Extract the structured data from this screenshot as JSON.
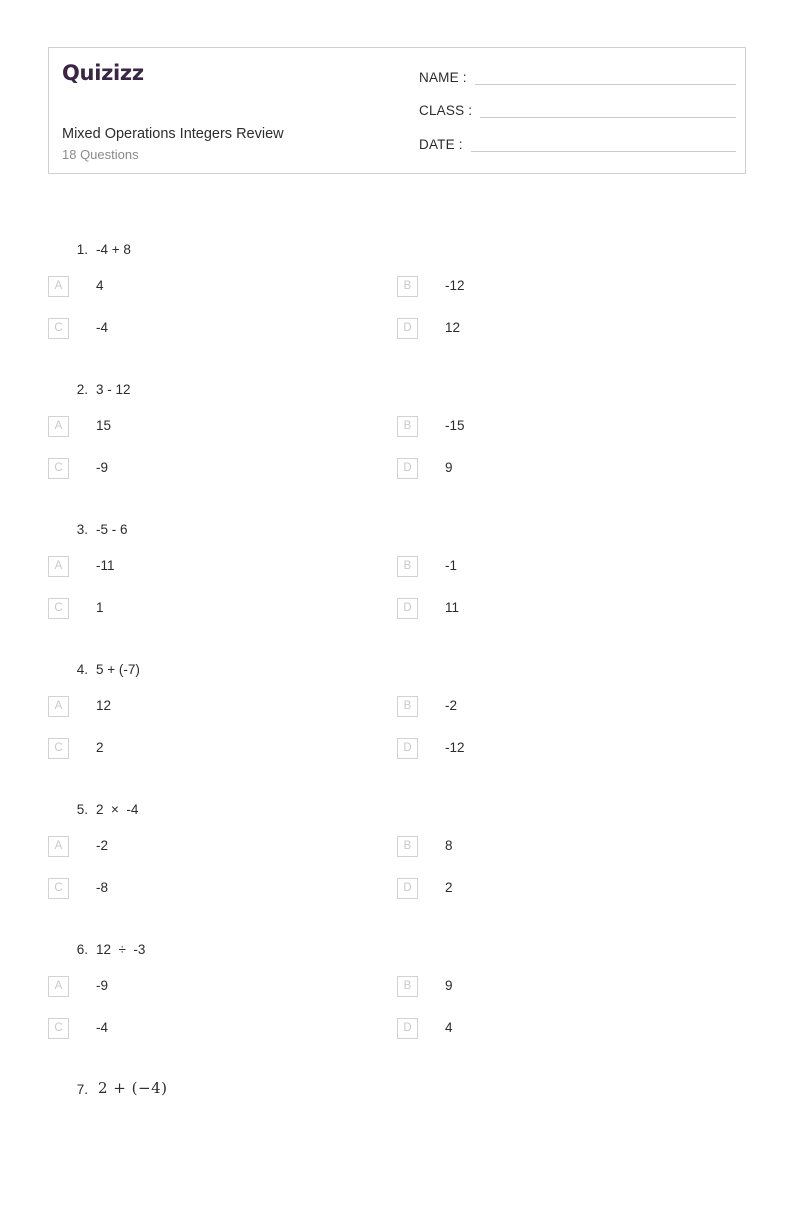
{
  "header": {
    "logo_text": "Quizizz",
    "logo_color": "#3b2544",
    "title": "Mixed Operations Integers Review",
    "subtitle": "18 Questions",
    "fields": [
      {
        "label": "NAME :",
        "value": ""
      },
      {
        "label": "CLASS :",
        "value": ""
      },
      {
        "label": "DATE  :",
        "value": ""
      }
    ]
  },
  "questions": [
    {
      "number": "1.",
      "text": "-4 + 8",
      "mathmode": false,
      "options": [
        {
          "letter": "A",
          "text": "4"
        },
        {
          "letter": "B",
          "text": "-12"
        },
        {
          "letter": "C",
          "text": "-4"
        },
        {
          "letter": "D",
          "text": "12"
        }
      ]
    },
    {
      "number": "2.",
      "text": "3 - 12",
      "mathmode": false,
      "options": [
        {
          "letter": "A",
          "text": "15"
        },
        {
          "letter": "B",
          "text": "-15"
        },
        {
          "letter": "C",
          "text": "-9"
        },
        {
          "letter": "D",
          "text": "9"
        }
      ]
    },
    {
      "number": "3.",
      "text": "-5 - 6",
      "mathmode": false,
      "options": [
        {
          "letter": "A",
          "text": "-11"
        },
        {
          "letter": "B",
          "text": "-1"
        },
        {
          "letter": "C",
          "text": "1"
        },
        {
          "letter": "D",
          "text": "11"
        }
      ]
    },
    {
      "number": "4.",
      "text": "5 + (-7)",
      "mathmode": false,
      "options": [
        {
          "letter": "A",
          "text": "12"
        },
        {
          "letter": "B",
          "text": "-2"
        },
        {
          "letter": "C",
          "text": "2"
        },
        {
          "letter": "D",
          "text": "-12"
        }
      ]
    },
    {
      "number": "5.",
      "text": "2  ×  -4",
      "mathmode": false,
      "options": [
        {
          "letter": "A",
          "text": "-2"
        },
        {
          "letter": "B",
          "text": "8"
        },
        {
          "letter": "C",
          "text": "-8"
        },
        {
          "letter": "D",
          "text": "2"
        }
      ]
    },
    {
      "number": "6.",
      "text": "12  ÷  -3",
      "mathmode": false,
      "options": [
        {
          "letter": "A",
          "text": "-9"
        },
        {
          "letter": "B",
          "text": "9"
        },
        {
          "letter": "C",
          "text": "-4"
        },
        {
          "letter": "D",
          "text": "4"
        }
      ]
    },
    {
      "number": "7.",
      "text": "2 + (−4)",
      "mathmode": true,
      "options": []
    }
  ]
}
